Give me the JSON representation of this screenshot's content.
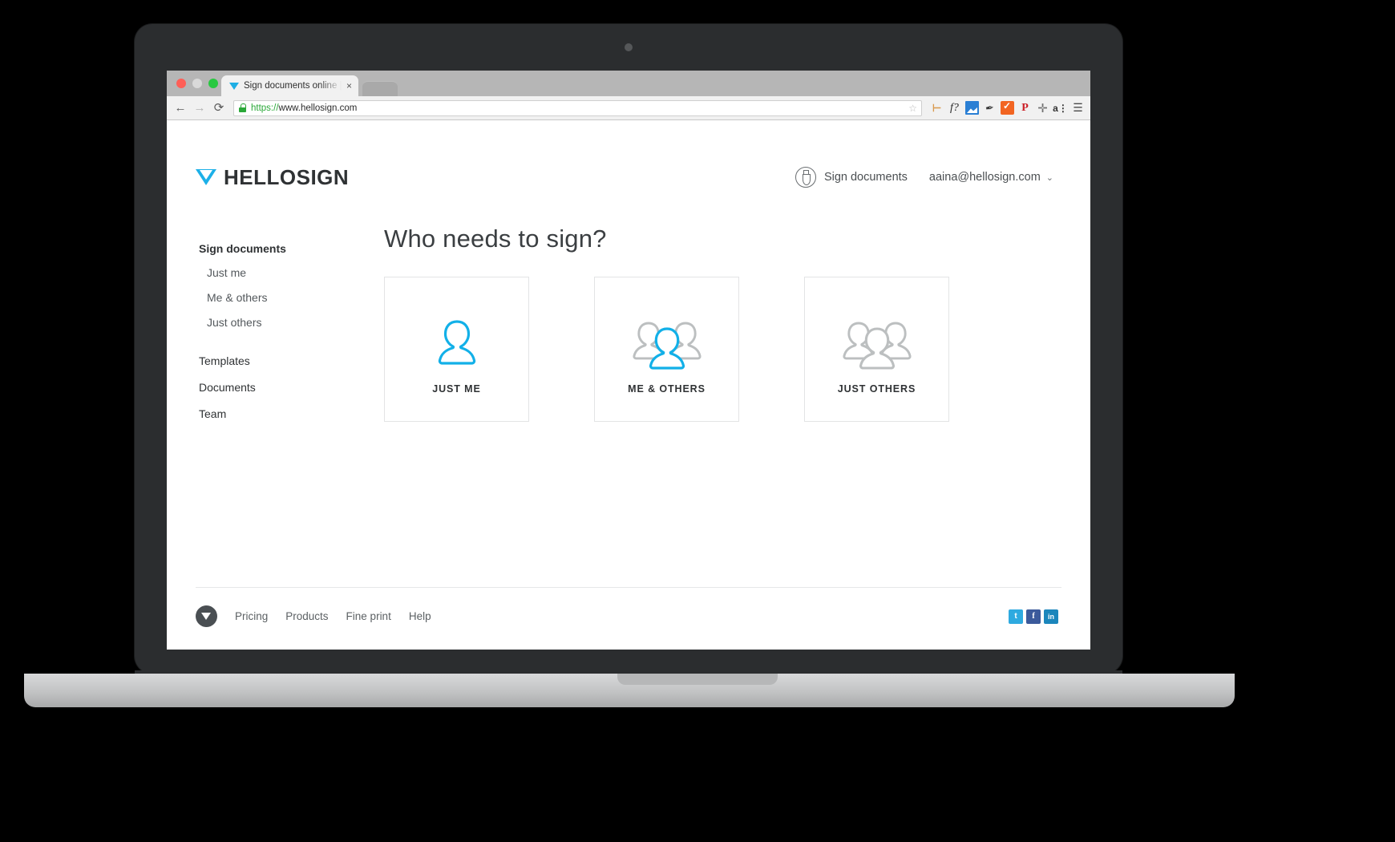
{
  "browser": {
    "tab": {
      "title": "Sign documents online | He",
      "close_label": "×",
      "favicon_name": "hellosign-favicon"
    },
    "toolbar": {
      "back_glyph": "←",
      "forward_glyph": "→",
      "reload_glyph": "⟳",
      "url_scheme": "https://",
      "url_rest": "www.hellosign.com",
      "star_glyph": "☆",
      "extensions": [
        {
          "name": "ruler-icon",
          "glyph": "⊢"
        },
        {
          "name": "fontface-icon",
          "glyph": "f?"
        },
        {
          "name": "image-icon",
          "glyph": ""
        },
        {
          "name": "eyedropper-icon",
          "glyph": "✒"
        },
        {
          "name": "checkbox-orange-icon",
          "glyph": ""
        },
        {
          "name": "pinterest-icon",
          "glyph": "P"
        },
        {
          "name": "crosshair-icon",
          "glyph": "✛"
        },
        {
          "name": "fontsize-icon",
          "glyph": "a"
        },
        {
          "name": "chrome-menu-icon",
          "glyph": "☰"
        }
      ]
    }
  },
  "header": {
    "logo_text": "HELLOSIGN",
    "sign_documents_label": "Sign documents",
    "account_email": "aaina@hellosign.com",
    "account_chevron": "⌄"
  },
  "sidebar": {
    "section_title": "Sign documents",
    "sub_items": [
      {
        "label": "Just me"
      },
      {
        "label": "Me & others"
      },
      {
        "label": "Just others"
      }
    ],
    "items": [
      {
        "label": "Templates"
      },
      {
        "label": "Documents"
      },
      {
        "label": "Team"
      }
    ]
  },
  "main": {
    "title": "Who needs to sign?",
    "cards": [
      {
        "label": "JUST ME",
        "icon": "single-person-icon",
        "highlight": "#12b0e8"
      },
      {
        "label": "ME & OTHERS",
        "icon": "person-with-group-icon",
        "highlight": "#12b0e8"
      },
      {
        "label": "JUST OTHERS",
        "icon": "group-of-people-icon",
        "highlight": "#b9bcbd"
      }
    ]
  },
  "footer": {
    "badge_name": "hellosign-badge-icon",
    "links": [
      {
        "label": "Pricing"
      },
      {
        "label": "Products"
      },
      {
        "label": "Fine print"
      },
      {
        "label": "Help"
      }
    ],
    "socials": [
      {
        "name": "twitter-icon",
        "glyph": "t",
        "color": "#2eaae0"
      },
      {
        "name": "facebook-icon",
        "glyph": "f",
        "color": "#3b5a9b"
      },
      {
        "name": "linkedin-icon",
        "glyph": "in",
        "color": "#1b86bc"
      }
    ]
  }
}
